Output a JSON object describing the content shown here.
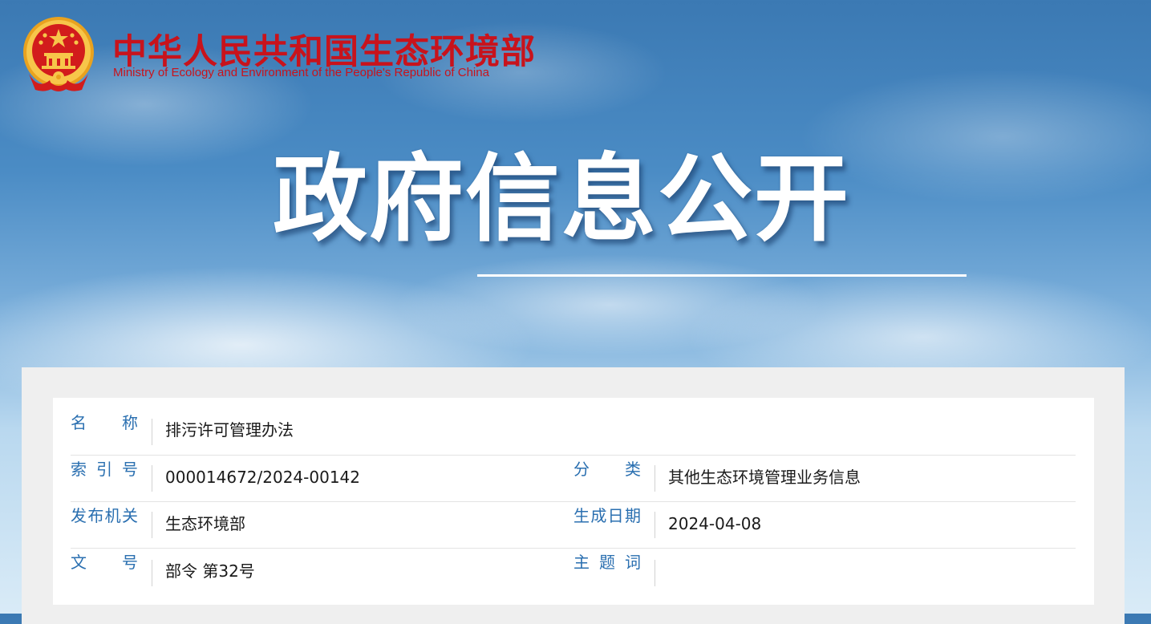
{
  "header": {
    "title": "中华人民共和国生态环境部",
    "subtitle": "Ministry of Ecology and Environment of the People's Republic of China",
    "emblem_icon": "national-emblem-icon"
  },
  "banner": {
    "title": "政府信息公开"
  },
  "info": {
    "rows": [
      {
        "left_label_chars": [
          "名",
          "称"
        ],
        "left_value": "排污许可管理办法"
      },
      {
        "left_label_chars": [
          "索",
          "引",
          "号"
        ],
        "left_value": "000014672/2024-00142",
        "right_label_chars": [
          "分",
          "类"
        ],
        "right_value": "其他生态环境管理业务信息"
      },
      {
        "left_label_chars": [
          "发",
          "布",
          "机",
          "关"
        ],
        "left_value": "生态环境部",
        "right_label_chars": [
          "生",
          "成",
          "日",
          "期"
        ],
        "right_value": "2024-04-08"
      },
      {
        "left_label_chars": [
          "文",
          "号"
        ],
        "left_value": "部令 第32号",
        "right_label_chars": [
          "主",
          "题",
          "词"
        ],
        "right_value": ""
      }
    ]
  },
  "colors": {
    "brand_red": "#c8131c",
    "label_blue": "#2a6fb0",
    "emblem_gold": "#f2b233"
  }
}
